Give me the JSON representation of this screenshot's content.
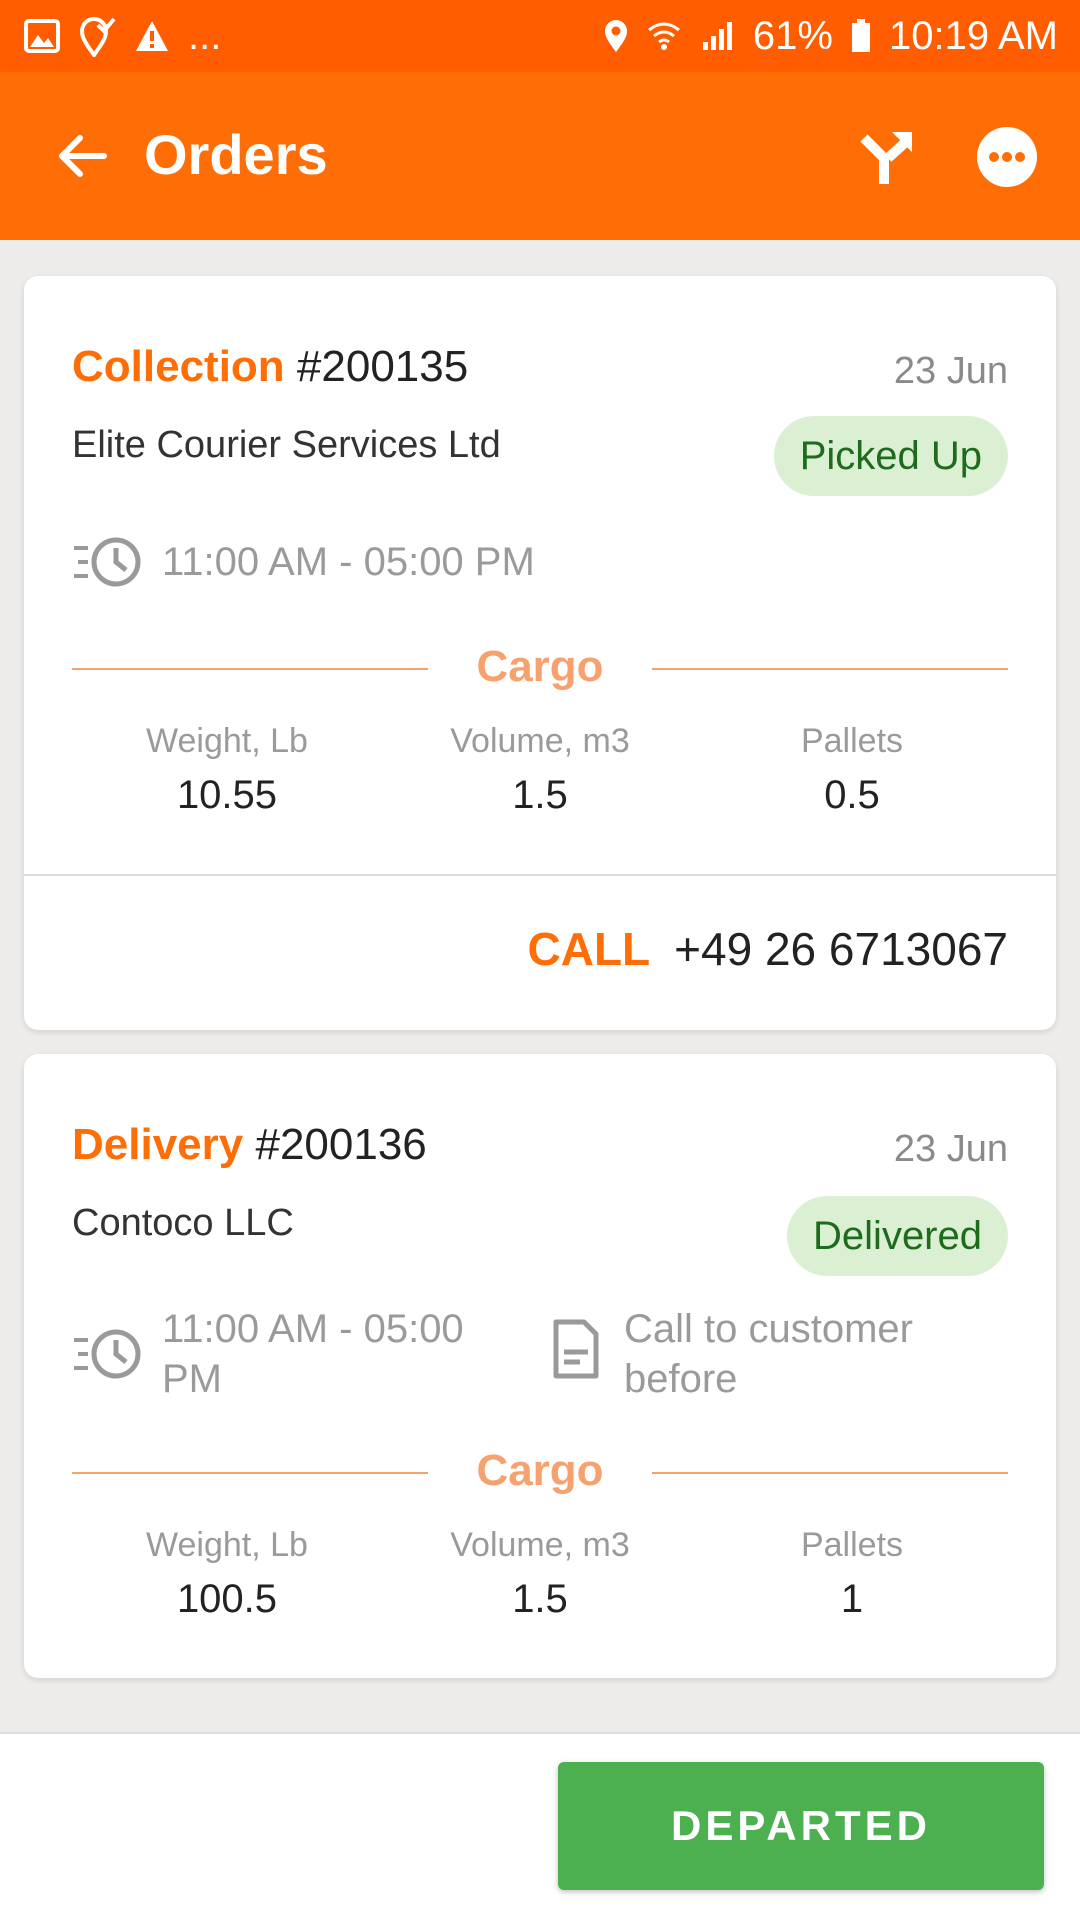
{
  "status_bar": {
    "icons": [
      "image-icon",
      "location-check-icon",
      "warning-icon",
      "location-pin-icon",
      "wifi-icon",
      "signal-icon",
      "battery-icon"
    ],
    "more": "...",
    "battery": "61%",
    "time": "10:19 AM"
  },
  "header": {
    "title": "Orders",
    "accent": "#ff6e06"
  },
  "orders": [
    {
      "type": "Collection",
      "number": "#200135",
      "date": "23 Jun",
      "company": "Elite Courier Services Ltd",
      "status": "Picked Up",
      "time": "11:00 AM - 05:00 PM",
      "cargo_title": "Cargo",
      "metrics": [
        {
          "label": "Weight, Lb",
          "value": "10.55"
        },
        {
          "label": "Volume, m3",
          "value": "1.5"
        },
        {
          "label": "Pallets",
          "value": "0.5"
        }
      ],
      "call_label": "CALL",
      "phone": "+49 26 6713067"
    },
    {
      "type": "Delivery",
      "number": "#200136",
      "date": "23 Jun",
      "company": "Contoco LLC",
      "status": "Delivered",
      "time_line1": "11:00 AM - 05:00",
      "time_line2": "PM",
      "note_line1": "Call to customer",
      "note_line2": "before",
      "cargo_title": "Cargo",
      "metrics": [
        {
          "label": "Weight, Lb",
          "value": "100.5"
        },
        {
          "label": "Volume, m3",
          "value": "1.5"
        },
        {
          "label": "Pallets",
          "value": "1"
        }
      ]
    }
  ],
  "footer": {
    "departed_label": "DEPARTED",
    "button_color": "#4caf50"
  }
}
